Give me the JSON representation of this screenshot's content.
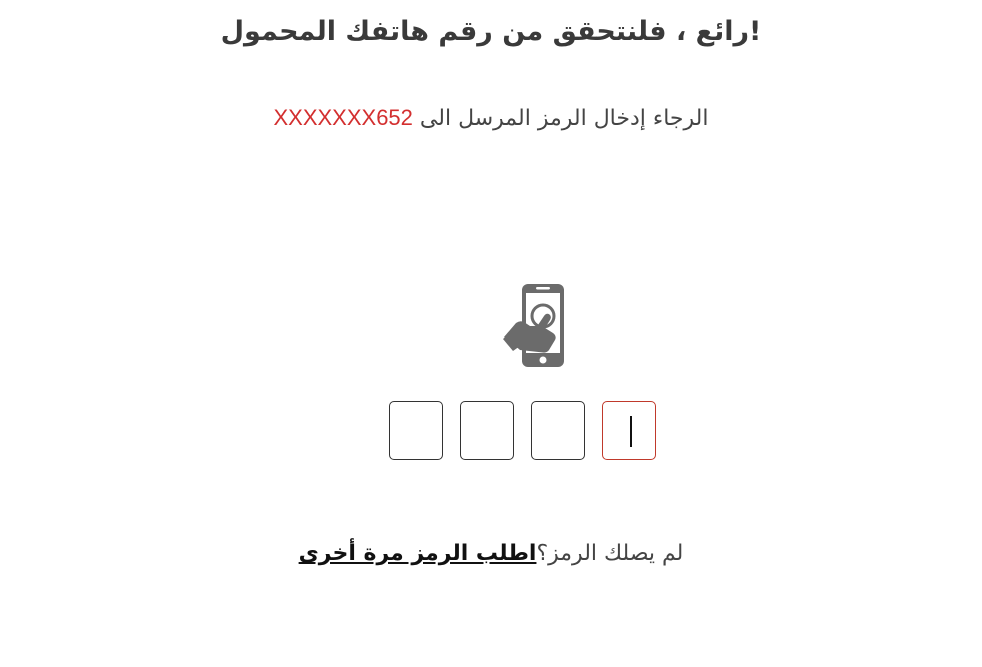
{
  "header": {
    "title": "رائع ، فلنتحقق من رقم هاتفك المحمول!"
  },
  "instruction": {
    "prefix": "الرجاء إدخال الرمز المرسل الى",
    "phone_masked": "XXXXXXX652"
  },
  "icon": {
    "name": "phone-touch-icon"
  },
  "otp": {
    "digits": [
      "",
      "",
      "",
      ""
    ],
    "active_index": 0
  },
  "resend": {
    "question": "لم يصلك الرمز؟",
    "link_label": "اطلب الرمز مرة أخرى"
  },
  "colors": {
    "accent_red": "#d32f2f",
    "icon_gray": "#6b6b6b",
    "text": "#333333"
  }
}
